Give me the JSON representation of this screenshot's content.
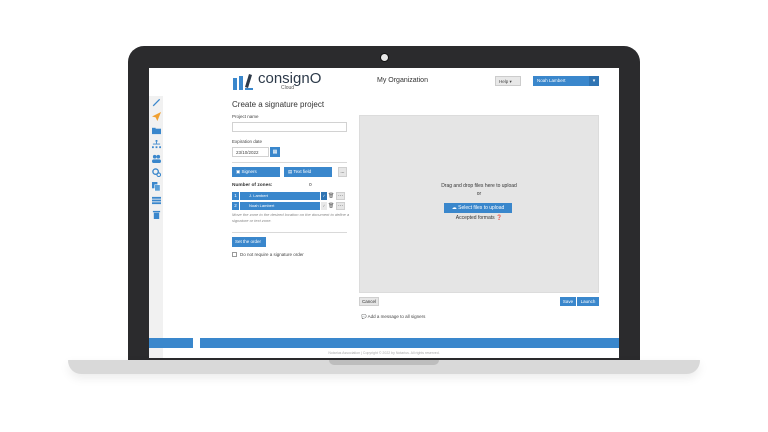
{
  "header": {
    "logo_text": "consignO",
    "logo_sub": "Cloud",
    "organization": "My Organization",
    "help_label": "Help",
    "help_caret": "▾",
    "user_label": "Noah Lambert",
    "user_caret": "▾"
  },
  "sidebar": {
    "items": [
      {
        "icon": "pencil-icon"
      },
      {
        "icon": "paper-plane-icon"
      },
      {
        "icon": "folder-icon"
      },
      {
        "icon": "org-chart-icon"
      },
      {
        "icon": "users-icon"
      },
      {
        "icon": "gears-icon"
      },
      {
        "icon": "copy-icon"
      },
      {
        "icon": "list-icon"
      },
      {
        "icon": "trash-icon"
      }
    ]
  },
  "form": {
    "page_title": "Create a signature project",
    "project_name_label": "Project name",
    "project_name_value": "",
    "expiration_label": "Expiration date",
    "expiration_value": "23/10/2022",
    "signers_btn": "Signers",
    "text_field_btn": "Text field",
    "more_btn": "...",
    "zones_label": "Number of zones:",
    "zones_count": "0",
    "zones": [
      {
        "index": "1",
        "name": "J. Lambert"
      },
      {
        "index": "2",
        "name": "Noah Lambert"
      }
    ],
    "hint": "Move the zone to the desired location on the document to define a signature or text zone.",
    "set_order_btn": "Set the order",
    "no_order_label": "Do not require a signature order"
  },
  "upload": {
    "drag_text": "Drag and drop files here to upload",
    "or_text": "or",
    "select_btn": "Select files to upload",
    "formats_text": "Accepted formats"
  },
  "actions": {
    "cancel": "Cancel",
    "save": "Save",
    "launch": "Launch",
    "message_link": "Add a message to all signers"
  },
  "footer": {
    "copyright": "Notarius Association | Copyright © 2022 by Notarius. All rights reserved."
  },
  "colors": {
    "accent": "#3a87cc",
    "frame": "#2b2b2d"
  }
}
